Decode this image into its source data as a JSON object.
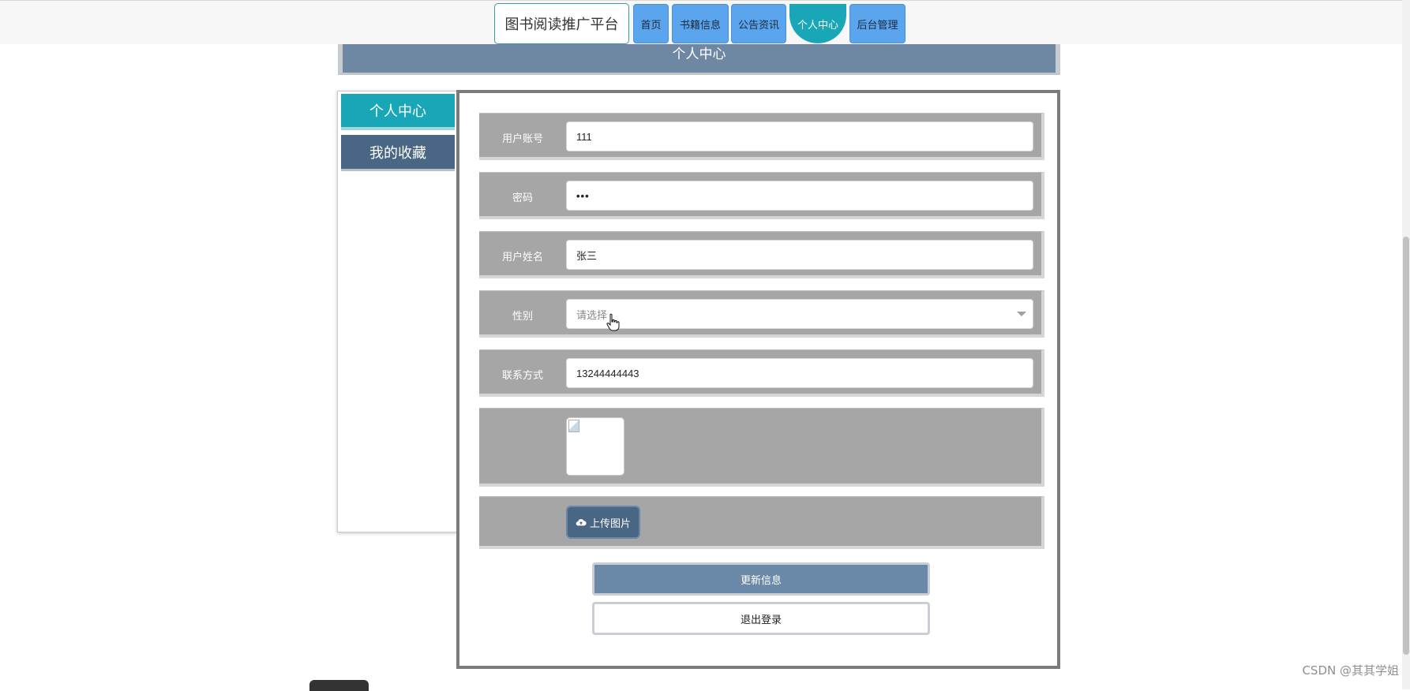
{
  "nav": {
    "brand": "图书阅读推广平台",
    "items": [
      {
        "label": "首页",
        "active": false
      },
      {
        "label": "书籍信息",
        "active": false
      },
      {
        "label": "公告资讯",
        "active": false
      },
      {
        "label": "个人中心",
        "active": true
      },
      {
        "label": "后台管理",
        "active": false
      }
    ]
  },
  "header": {
    "title": "个人中心"
  },
  "sidebar": {
    "items": [
      {
        "label": "个人中心",
        "active": true
      },
      {
        "label": "我的收藏",
        "active": false
      }
    ]
  },
  "form": {
    "account_label": "用户账号",
    "account_value": "111",
    "password_label": "密码",
    "password_value": "•••",
    "name_label": "用户姓名",
    "name_value": "张三",
    "gender_label": "性别",
    "gender_placeholder": "请选择",
    "phone_label": "联系方式",
    "phone_value": "13244444443",
    "upload_label": "上传图片",
    "update_label": "更新信息",
    "logout_label": "退出登录"
  },
  "icons": {
    "upload": "cloud-upload-icon",
    "dropdown": "chevron-down-icon",
    "broken_image": "broken-image-icon"
  },
  "colors": {
    "nav_button": "#5aa5ee",
    "accent": "#19a7b7",
    "header_bar": "#6e87a3",
    "side_secondary": "#4a6685",
    "form_row": "#a6a6a6",
    "update_button": "#6a88a8"
  },
  "watermark": "CSDN @其其学姐"
}
